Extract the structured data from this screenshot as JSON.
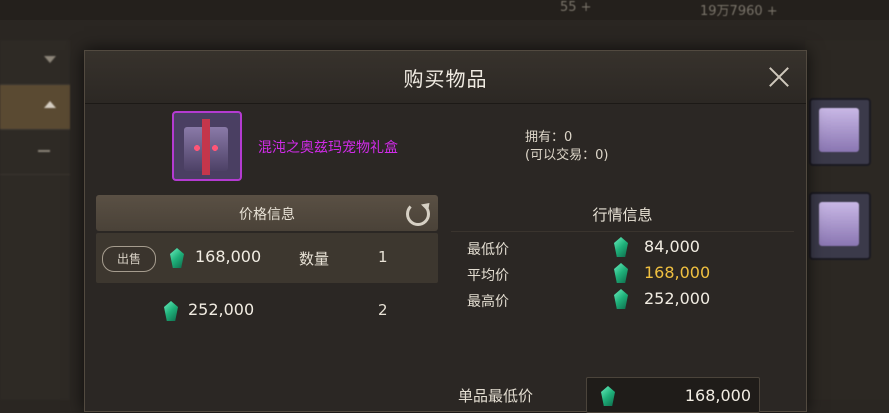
{
  "background": {
    "top_values": [
      "55 +",
      "19万7960 +"
    ]
  },
  "modal": {
    "title": "购买物品"
  },
  "item": {
    "name": "混沌之奥兹玛宠物礼盒",
    "owned_label": "拥有：0",
    "tradable_label": "(可以交易：0)"
  },
  "price_info": {
    "header": "价格信息",
    "rows": [
      {
        "badge": "出售",
        "price": "168,000",
        "qty_label": "数量",
        "qty": "1"
      },
      {
        "badge": "",
        "price": "252,000",
        "qty_label": "",
        "qty": "2"
      }
    ]
  },
  "market_info": {
    "header": "行情信息",
    "rows": [
      {
        "label": "最低价",
        "value": "84,000"
      },
      {
        "label": "平均价",
        "value": "168,000"
      },
      {
        "label": "最高价",
        "value": "252,000"
      }
    ]
  },
  "unit_min": {
    "label": "单品最低价",
    "value": "168,000"
  },
  "colors": {
    "item_name": "#d02be8",
    "average_price": "#f0c040",
    "gem": "#1fb07a"
  }
}
